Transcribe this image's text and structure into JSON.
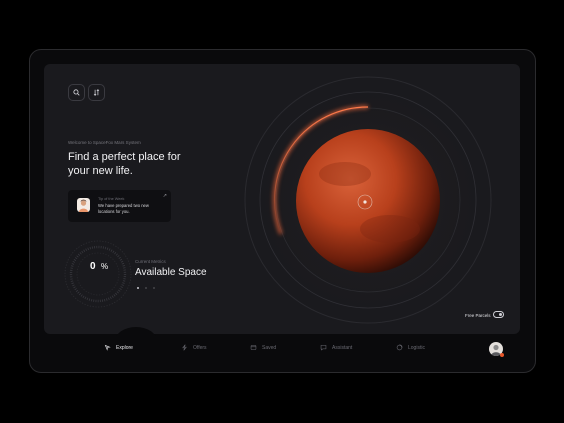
{
  "header": {
    "search_icon": "search-icon",
    "filter_icon": "filter-icon"
  },
  "hero": {
    "welcome": "Welcome to SpaceFox Mars System",
    "headline": "Find a perfect place for your new life."
  },
  "tip": {
    "title": "Tip of the Week",
    "text": "We have prepared two new locations for you.",
    "arrow_icon": "arrow-up-right-icon"
  },
  "metric": {
    "value": "0",
    "unit": "%",
    "label": "Current Metrics",
    "title": "Available Space",
    "pages_total": 3,
    "active_page": 1
  },
  "controls": {
    "free_parcels_label": "Free Parcels",
    "free_parcels_enabled": true
  },
  "nav": {
    "tabs": [
      {
        "label": "Explore",
        "icon": "explore-icon",
        "active": true
      },
      {
        "label": "Offers",
        "icon": "bolt-icon",
        "active": false
      },
      {
        "label": "Saved",
        "icon": "saved-icon",
        "active": false
      },
      {
        "label": "Assistant",
        "icon": "chat-icon",
        "active": false
      },
      {
        "label": "Logistic",
        "icon": "logistic-icon",
        "active": false
      }
    ]
  },
  "colors": {
    "background": "#000000",
    "screen": "#1a1a1e",
    "accent": "#e6562a",
    "planet": "#b8401c"
  }
}
